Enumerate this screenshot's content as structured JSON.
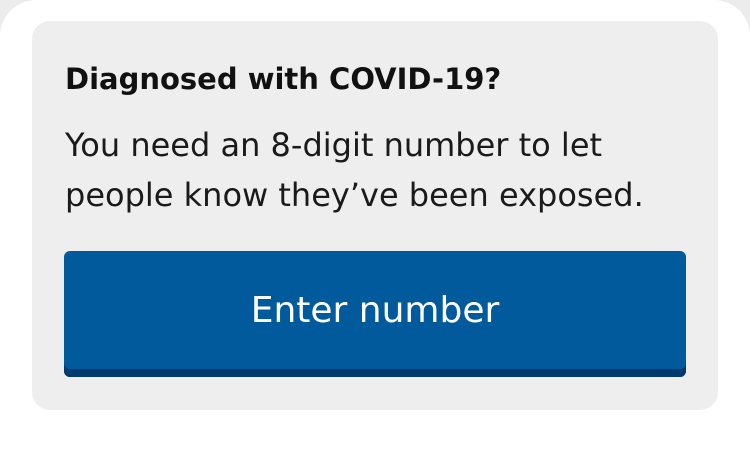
{
  "exposure_card": {
    "title": "Diagnosed with COVID-19?",
    "body_line_1": "You need an 8-digit number to let",
    "body_line_2": "people know they’ve been exposed.",
    "button_label": "Enter number"
  },
  "colors": {
    "card_background": "#eeeeee",
    "button_background": "#005a9c",
    "button_shadow": "#003a6e",
    "text": "#111111"
  }
}
